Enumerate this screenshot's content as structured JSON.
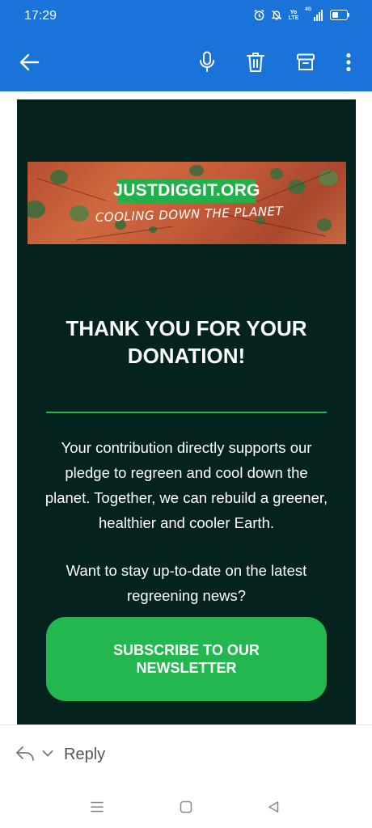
{
  "status": {
    "time": "17:29",
    "network_label": "Yo LTE",
    "signal_label": "4G",
    "icons": [
      "alarm-icon",
      "bell-off-icon",
      "volte-icon",
      "signal-icon",
      "battery-icon"
    ]
  },
  "app_bar": {
    "icons": [
      "back-arrow-icon",
      "microphone-icon",
      "delete-icon",
      "archive-icon",
      "more-vert-icon"
    ],
    "color": "#1a73d9"
  },
  "email": {
    "background": "#04231e",
    "banner": {
      "title": "JUSTDIGGIT.ORG",
      "tagline": "Cooling Down the Planet"
    },
    "heading_line1": "THANK YOU FOR YOUR",
    "heading_line2": "DONATION!",
    "paragraph1": "Your contribution directly supports our pledge to regreen and cool down the planet. Together, we can rebuild a greener, healthier and cooler Earth.",
    "paragraph2": "Want to stay up-to-date on the latest regreening news?",
    "subscribe_button": "SUBSCRIBE TO OUR NEWSLETTER",
    "accent": "#22b84f"
  },
  "reply_bar": {
    "reply_label": "Reply",
    "icons": [
      "reply-icon",
      "chevron-down-icon"
    ]
  },
  "nav_bar": {
    "icons": [
      "menu-icon",
      "home-square-icon",
      "back-triangle-icon"
    ]
  }
}
